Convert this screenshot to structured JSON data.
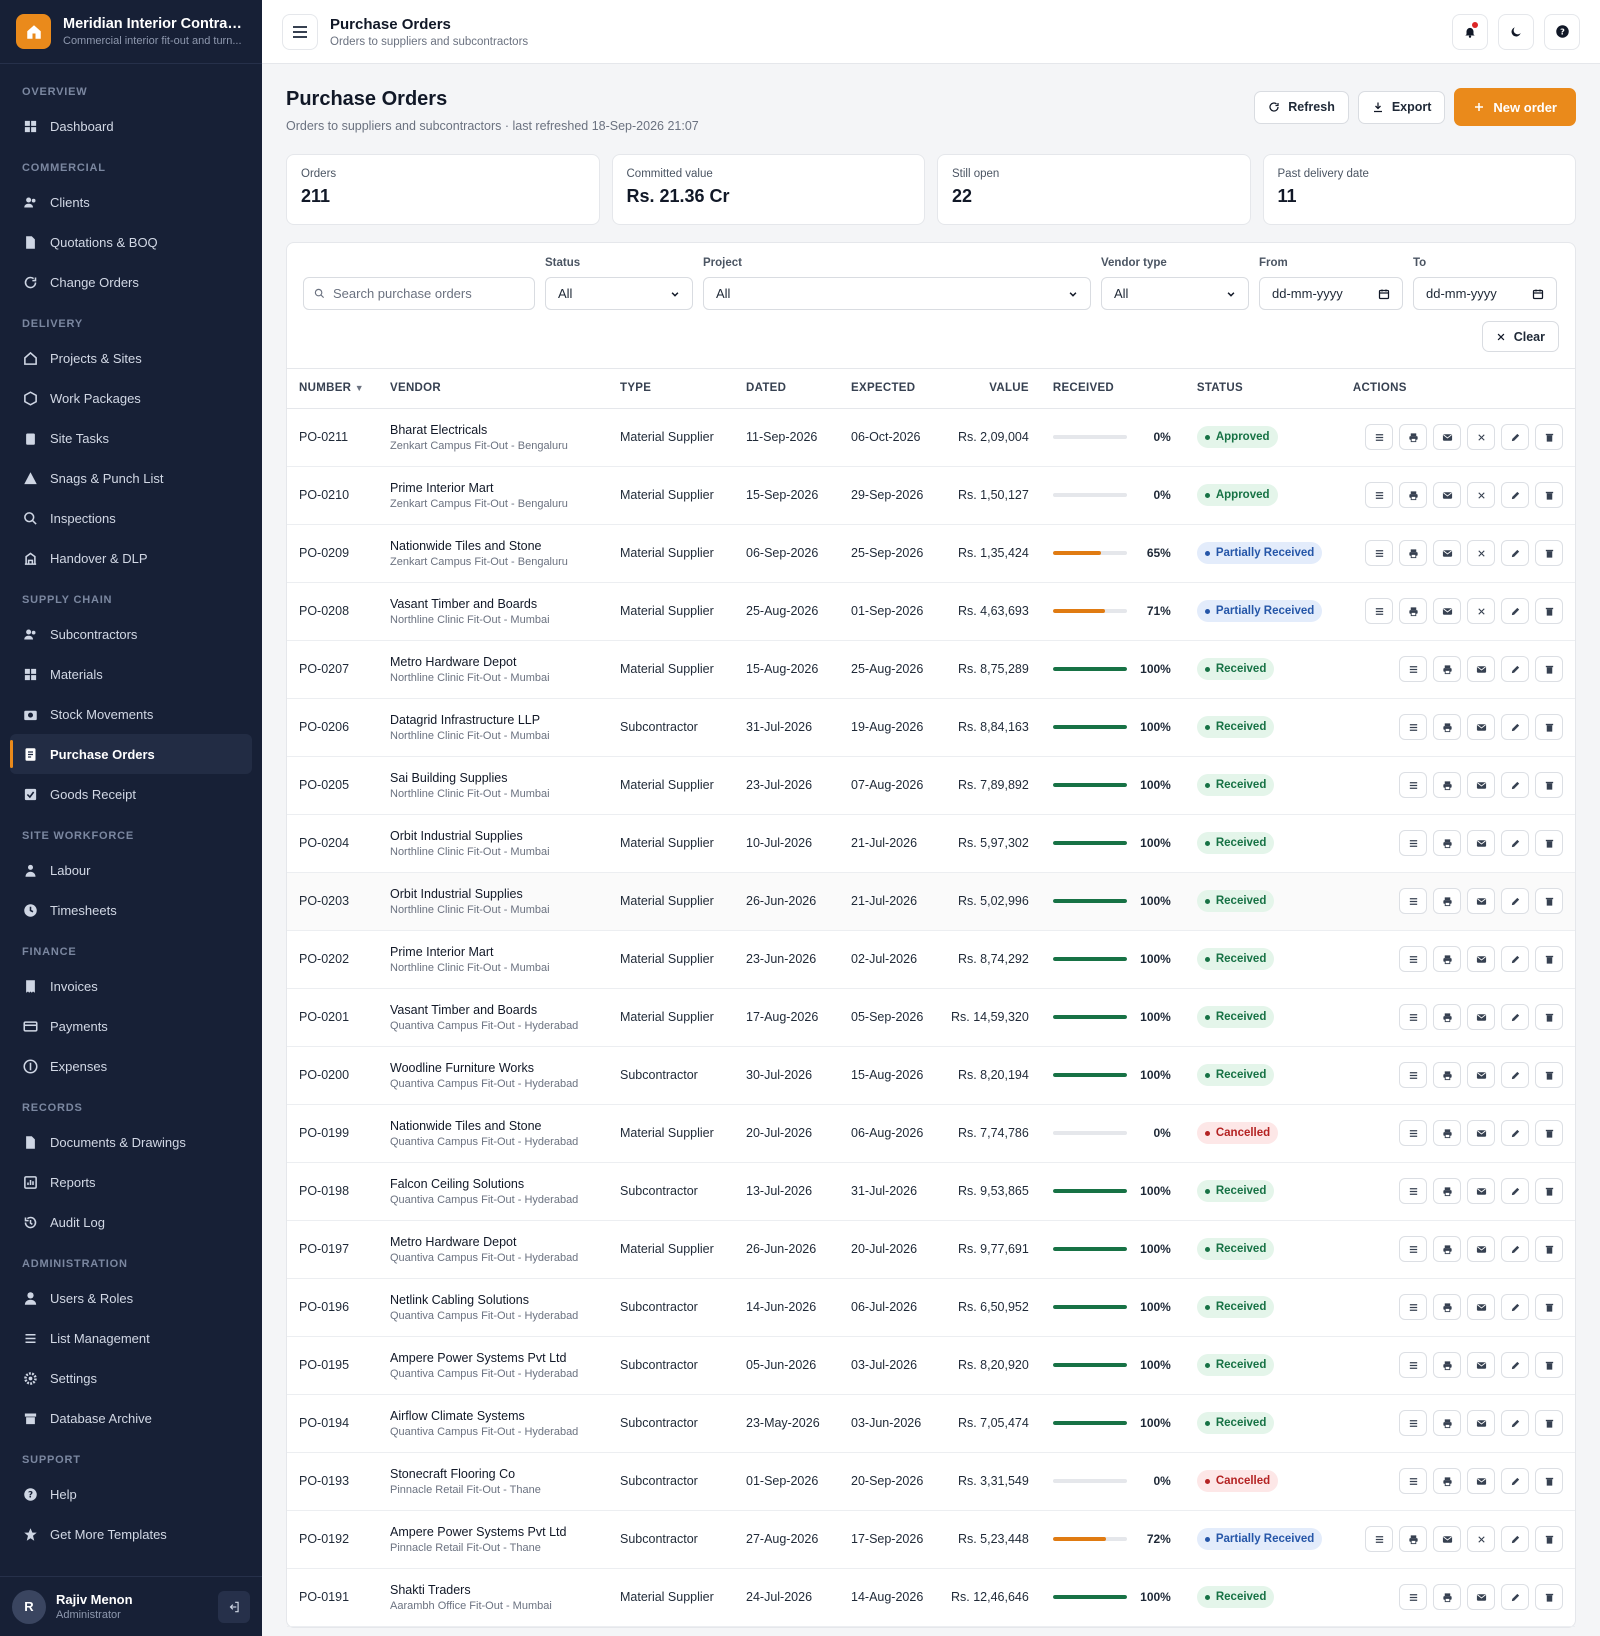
{
  "brand": {
    "name": "Meridian Interior Contract...",
    "subtitle": "Commercial interior fit-out and turn..."
  },
  "nav": [
    {
      "section": "OVERVIEW",
      "items": [
        {
          "label": "Dashboard",
          "icon": "grid-icon"
        }
      ]
    },
    {
      "section": "COMMERCIAL",
      "items": [
        {
          "label": "Clients",
          "icon": "users-icon"
        },
        {
          "label": "Quotations & BOQ",
          "icon": "document-icon"
        },
        {
          "label": "Change Orders",
          "icon": "refresh-icon"
        }
      ]
    },
    {
      "section": "DELIVERY",
      "items": [
        {
          "label": "Projects & Sites",
          "icon": "home-icon"
        },
        {
          "label": "Work Packages",
          "icon": "box-icon"
        },
        {
          "label": "Site Tasks",
          "icon": "clipboard-icon"
        },
        {
          "label": "Snags & Punch List",
          "icon": "warning-icon"
        },
        {
          "label": "Inspections",
          "icon": "search-icon"
        },
        {
          "label": "Handover & DLP",
          "icon": "building-icon"
        }
      ]
    },
    {
      "section": "SUPPLY CHAIN",
      "items": [
        {
          "label": "Subcontractors",
          "icon": "users-icon"
        },
        {
          "label": "Materials",
          "icon": "grid-icon"
        },
        {
          "label": "Stock Movements",
          "icon": "camera-icon"
        },
        {
          "label": "Purchase Orders",
          "icon": "order-icon",
          "active": true
        },
        {
          "label": "Goods Receipt",
          "icon": "check-square-icon"
        }
      ]
    },
    {
      "section": "SITE WORKFORCE",
      "items": [
        {
          "label": "Labour",
          "icon": "worker-icon"
        },
        {
          "label": "Timesheets",
          "icon": "clock-icon"
        }
      ]
    },
    {
      "section": "FINANCE",
      "items": [
        {
          "label": "Invoices",
          "icon": "invoice-icon"
        },
        {
          "label": "Payments",
          "icon": "card-icon"
        },
        {
          "label": "Expenses",
          "icon": "coin-icon"
        }
      ]
    },
    {
      "section": "RECORDS",
      "items": [
        {
          "label": "Documents & Drawings",
          "icon": "file-icon"
        },
        {
          "label": "Reports",
          "icon": "chart-icon"
        },
        {
          "label": "Audit Log",
          "icon": "history-icon"
        }
      ]
    },
    {
      "section": "ADMINISTRATION",
      "items": [
        {
          "label": "Users & Roles",
          "icon": "user-icon"
        },
        {
          "label": "List Management",
          "icon": "list-icon"
        },
        {
          "label": "Settings",
          "icon": "gear-icon"
        },
        {
          "label": "Database Archive",
          "icon": "archive-icon"
        }
      ]
    },
    {
      "section": "SUPPORT",
      "items": [
        {
          "label": "Help",
          "icon": "help-icon"
        },
        {
          "label": "Get More Templates",
          "icon": "star-icon"
        }
      ]
    }
  ],
  "user": {
    "initial": "R",
    "name": "Rajiv Menon",
    "role": "Administrator"
  },
  "topbar": {
    "title": "Purchase Orders",
    "subtitle": "Orders to suppliers and subcontractors"
  },
  "page": {
    "title": "Purchase Orders",
    "subtitle": "Orders to suppliers and subcontractors · last refreshed 18-Sep-2026 21:07",
    "refresh_label": "Refresh",
    "export_label": "Export",
    "new_label": "New order"
  },
  "stats": [
    {
      "label": "Orders",
      "value": "211"
    },
    {
      "label": "Committed value",
      "value": "Rs. 21.36 Cr"
    },
    {
      "label": "Still open",
      "value": "22"
    },
    {
      "label": "Past delivery date",
      "value": "11"
    }
  ],
  "filters": {
    "search_placeholder": "Search purchase orders",
    "status_label": "Status",
    "status_value": "All",
    "project_label": "Project",
    "project_value": "All",
    "vendor_type_label": "Vendor type",
    "vendor_type_value": "All",
    "from_label": "From",
    "from_value": "dd-mm-yyyy",
    "to_label": "To",
    "to_value": "dd-mm-yyyy",
    "clear_label": "Clear"
  },
  "table": {
    "columns": [
      "NUMBER",
      "VENDOR",
      "TYPE",
      "DATED",
      "EXPECTED",
      "VALUE",
      "RECEIVED",
      "STATUS",
      "ACTIONS"
    ],
    "rows": [
      {
        "number": "PO-0211",
        "vendor": "Bharat Electricals",
        "project": "Zenkart Campus Fit-Out - Bengaluru",
        "type": "Material Supplier",
        "dated": "11-Sep-2026",
        "expected": "06-Oct-2026",
        "value": "Rs. 2,09,004",
        "received": 0,
        "received_label": "0%",
        "status": "Approved"
      },
      {
        "number": "PO-0210",
        "vendor": "Prime Interior Mart",
        "project": "Zenkart Campus Fit-Out - Bengaluru",
        "type": "Material Supplier",
        "dated": "15-Sep-2026",
        "expected": "29-Sep-2026",
        "value": "Rs. 1,50,127",
        "received": 0,
        "received_label": "0%",
        "status": "Approved"
      },
      {
        "number": "PO-0209",
        "vendor": "Nationwide Tiles and Stone",
        "project": "Zenkart Campus Fit-Out - Bengaluru",
        "type": "Material Supplier",
        "dated": "06-Sep-2026",
        "expected": "25-Sep-2026",
        "value": "Rs. 1,35,424",
        "received": 65,
        "received_label": "65%",
        "status": "Partially Received"
      },
      {
        "number": "PO-0208",
        "vendor": "Vasant Timber and Boards",
        "project": "Northline Clinic Fit-Out - Mumbai",
        "type": "Material Supplier",
        "dated": "25-Aug-2026",
        "expected": "01-Sep-2026",
        "value": "Rs. 4,63,693",
        "received": 71,
        "received_label": "71%",
        "status": "Partially Received"
      },
      {
        "number": "PO-0207",
        "vendor": "Metro Hardware Depot",
        "project": "Northline Clinic Fit-Out - Mumbai",
        "type": "Material Supplier",
        "dated": "15-Aug-2026",
        "expected": "25-Aug-2026",
        "value": "Rs. 8,75,289",
        "received": 100,
        "received_label": "100%",
        "status": "Received"
      },
      {
        "number": "PO-0206",
        "vendor": "Datagrid Infrastructure LLP",
        "project": "Northline Clinic Fit-Out - Mumbai",
        "type": "Subcontractor",
        "dated": "31-Jul-2026",
        "expected": "19-Aug-2026",
        "value": "Rs. 8,84,163",
        "received": 100,
        "received_label": "100%",
        "status": "Received"
      },
      {
        "number": "PO-0205",
        "vendor": "Sai Building Supplies",
        "project": "Northline Clinic Fit-Out - Mumbai",
        "type": "Material Supplier",
        "dated": "23-Jul-2026",
        "expected": "07-Aug-2026",
        "value": "Rs. 7,89,892",
        "received": 100,
        "received_label": "100%",
        "status": "Received"
      },
      {
        "number": "PO-0204",
        "vendor": "Orbit Industrial Supplies",
        "project": "Northline Clinic Fit-Out - Mumbai",
        "type": "Material Supplier",
        "dated": "10-Jul-2026",
        "expected": "21-Jul-2026",
        "value": "Rs. 5,97,302",
        "received": 100,
        "received_label": "100%",
        "status": "Received"
      },
      {
        "number": "PO-0203",
        "vendor": "Orbit Industrial Supplies",
        "project": "Northline Clinic Fit-Out - Mumbai",
        "type": "Material Supplier",
        "dated": "26-Jun-2026",
        "expected": "21-Jul-2026",
        "value": "Rs. 5,02,996",
        "received": 100,
        "received_label": "100%",
        "status": "Received"
      },
      {
        "number": "PO-0202",
        "vendor": "Prime Interior Mart",
        "project": "Northline Clinic Fit-Out - Mumbai",
        "type": "Material Supplier",
        "dated": "23-Jun-2026",
        "expected": "02-Jul-2026",
        "value": "Rs. 8,74,292",
        "received": 100,
        "received_label": "100%",
        "status": "Received"
      },
      {
        "number": "PO-0201",
        "vendor": "Vasant Timber and Boards",
        "project": "Quantiva Campus Fit-Out - Hyderabad",
        "type": "Material Supplier",
        "dated": "17-Aug-2026",
        "expected": "05-Sep-2026",
        "value": "Rs. 14,59,320",
        "received": 100,
        "received_label": "100%",
        "status": "Received"
      },
      {
        "number": "PO-0200",
        "vendor": "Woodline Furniture Works",
        "project": "Quantiva Campus Fit-Out - Hyderabad",
        "type": "Subcontractor",
        "dated": "30-Jul-2026",
        "expected": "15-Aug-2026",
        "value": "Rs. 8,20,194",
        "received": 100,
        "received_label": "100%",
        "status": "Received"
      },
      {
        "number": "PO-0199",
        "vendor": "Nationwide Tiles and Stone",
        "project": "Quantiva Campus Fit-Out - Hyderabad",
        "type": "Material Supplier",
        "dated": "20-Jul-2026",
        "expected": "06-Aug-2026",
        "value": "Rs. 7,74,786",
        "received": 0,
        "received_label": "0%",
        "status": "Cancelled"
      },
      {
        "number": "PO-0198",
        "vendor": "Falcon Ceiling Solutions",
        "project": "Quantiva Campus Fit-Out - Hyderabad",
        "type": "Subcontractor",
        "dated": "13-Jul-2026",
        "expected": "31-Jul-2026",
        "value": "Rs. 9,53,865",
        "received": 100,
        "received_label": "100%",
        "status": "Received"
      },
      {
        "number": "PO-0197",
        "vendor": "Metro Hardware Depot",
        "project": "Quantiva Campus Fit-Out - Hyderabad",
        "type": "Material Supplier",
        "dated": "26-Jun-2026",
        "expected": "20-Jul-2026",
        "value": "Rs. 9,77,691",
        "received": 100,
        "received_label": "100%",
        "status": "Received"
      },
      {
        "number": "PO-0196",
        "vendor": "Netlink Cabling Solutions",
        "project": "Quantiva Campus Fit-Out - Hyderabad",
        "type": "Subcontractor",
        "dated": "14-Jun-2026",
        "expected": "06-Jul-2026",
        "value": "Rs. 6,50,952",
        "received": 100,
        "received_label": "100%",
        "status": "Received"
      },
      {
        "number": "PO-0195",
        "vendor": "Ampere Power Systems Pvt Ltd",
        "project": "Quantiva Campus Fit-Out - Hyderabad",
        "type": "Subcontractor",
        "dated": "05-Jun-2026",
        "expected": "03-Jul-2026",
        "value": "Rs. 8,20,920",
        "received": 100,
        "received_label": "100%",
        "status": "Received"
      },
      {
        "number": "PO-0194",
        "vendor": "Airflow Climate Systems",
        "project": "Quantiva Campus Fit-Out - Hyderabad",
        "type": "Subcontractor",
        "dated": "23-May-2026",
        "expected": "03-Jun-2026",
        "value": "Rs. 7,05,474",
        "received": 100,
        "received_label": "100%",
        "status": "Received"
      },
      {
        "number": "PO-0193",
        "vendor": "Stonecraft Flooring Co",
        "project": "Pinnacle Retail Fit-Out - Thane",
        "type": "Subcontractor",
        "dated": "01-Sep-2026",
        "expected": "20-Sep-2026",
        "value": "Rs. 3,31,549",
        "received": 0,
        "received_label": "0%",
        "status": "Cancelled"
      },
      {
        "number": "PO-0192",
        "vendor": "Ampere Power Systems Pvt Ltd",
        "project": "Pinnacle Retail Fit-Out - Thane",
        "type": "Subcontractor",
        "dated": "27-Aug-2026",
        "expected": "17-Sep-2026",
        "value": "Rs. 5,23,448",
        "received": 72,
        "received_label": "72%",
        "status": "Partially Received"
      },
      {
        "number": "PO-0191",
        "vendor": "Shakti Traders",
        "project": "Aarambh Office Fit-Out - Mumbai",
        "type": "Material Supplier",
        "dated": "24-Jul-2026",
        "expected": "14-Aug-2026",
        "value": "Rs. 12,46,646",
        "received": 100,
        "received_label": "100%",
        "status": "Received"
      }
    ]
  },
  "colors": {
    "accent": "#ea8a1b",
    "sidebar_bg": "#172036",
    "progress_full": "#177245",
    "progress_partial": "#e07b12"
  }
}
